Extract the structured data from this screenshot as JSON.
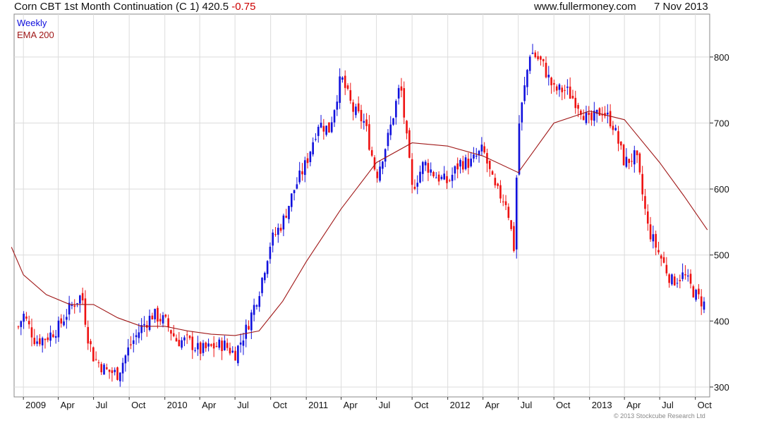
{
  "header": {
    "title": "Corn CBT 1st Month Continuation (C 1) 420.5",
    "change": "-0.75",
    "source": "www.fullermoney.com",
    "date": "7 Nov 2013"
  },
  "copyright": "© 2013 Stockcube Research Ltd",
  "colors": {
    "up": "#1010dd",
    "down": "#ee1111",
    "ema": "#a01818",
    "grid": "#dcdcdc",
    "frame": "#888888"
  },
  "chart_data": {
    "type": "candlestick",
    "frequency": "Weekly",
    "legend": [
      "Weekly",
      "EMA 200"
    ],
    "legend_placement": "top-left",
    "y_axis_side": "right",
    "ylim": [
      285,
      865
    ],
    "yticks": [
      300,
      400,
      500,
      600,
      700,
      800
    ],
    "x_ticks": [
      {
        "label": "2009",
        "date": "2009-01"
      },
      {
        "label": "Apr",
        "date": "2009-04"
      },
      {
        "label": "Jul",
        "date": "2009-07"
      },
      {
        "label": "Oct",
        "date": "2009-10"
      },
      {
        "label": "2010",
        "date": "2010-01"
      },
      {
        "label": "Apr",
        "date": "2010-04"
      },
      {
        "label": "Jul",
        "date": "2010-07"
      },
      {
        "label": "Oct",
        "date": "2010-10"
      },
      {
        "label": "2011",
        "date": "2011-01"
      },
      {
        "label": "Apr",
        "date": "2011-04"
      },
      {
        "label": "Jul",
        "date": "2011-07"
      },
      {
        "label": "Oct",
        "date": "2011-10"
      },
      {
        "label": "2012",
        "date": "2012-01"
      },
      {
        "label": "Apr",
        "date": "2012-04"
      },
      {
        "label": "Jul",
        "date": "2012-07"
      },
      {
        "label": "Oct",
        "date": "2012-10"
      },
      {
        "label": "2013",
        "date": "2013-01"
      },
      {
        "label": "Apr",
        "date": "2013-04"
      },
      {
        "label": "Jul",
        "date": "2013-07"
      },
      {
        "label": "Oct",
        "date": "2013-10"
      }
    ],
    "close_series": [
      {
        "date": "2008-12",
        "close": 365
      },
      {
        "date": "2009-01",
        "close": 410
      },
      {
        "date": "2009-02",
        "close": 370
      },
      {
        "date": "2009-03",
        "close": 375
      },
      {
        "date": "2009-04",
        "close": 390
      },
      {
        "date": "2009-05",
        "close": 420
      },
      {
        "date": "2009-06",
        "close": 440
      },
      {
        "date": "2009-06-15",
        "close": 380
      },
      {
        "date": "2009-07",
        "close": 345
      },
      {
        "date": "2009-08",
        "close": 325
      },
      {
        "date": "2009-09",
        "close": 320
      },
      {
        "date": "2009-10",
        "close": 360
      },
      {
        "date": "2009-11",
        "close": 390
      },
      {
        "date": "2009-12",
        "close": 410
      },
      {
        "date": "2010-01",
        "close": 400
      },
      {
        "date": "2010-02",
        "close": 370
      },
      {
        "date": "2010-03",
        "close": 370
      },
      {
        "date": "2010-04",
        "close": 355
      },
      {
        "date": "2010-05",
        "close": 360
      },
      {
        "date": "2010-06",
        "close": 365
      },
      {
        "date": "2010-07",
        "close": 350
      },
      {
        "date": "2010-08",
        "close": 390
      },
      {
        "date": "2010-09",
        "close": 445
      },
      {
        "date": "2010-10",
        "close": 520
      },
      {
        "date": "2010-11",
        "close": 550
      },
      {
        "date": "2010-12",
        "close": 600
      },
      {
        "date": "2011-01",
        "close": 640
      },
      {
        "date": "2011-02",
        "close": 700
      },
      {
        "date": "2011-03",
        "close": 690
      },
      {
        "date": "2011-04",
        "close": 770
      },
      {
        "date": "2011-05",
        "close": 720
      },
      {
        "date": "2011-06",
        "close": 700
      },
      {
        "date": "2011-07",
        "close": 620
      },
      {
        "date": "2011-08",
        "close": 680
      },
      {
        "date": "2011-09",
        "close": 760
      },
      {
        "date": "2011-10",
        "close": 600
      },
      {
        "date": "2011-11",
        "close": 640
      },
      {
        "date": "2011-12",
        "close": 620
      },
      {
        "date": "2012-01",
        "close": 610
      },
      {
        "date": "2012-02",
        "close": 640
      },
      {
        "date": "2012-03",
        "close": 640
      },
      {
        "date": "2012-04",
        "close": 660
      },
      {
        "date": "2012-05",
        "close": 600
      },
      {
        "date": "2012-06",
        "close": 580
      },
      {
        "date": "2012-06-20",
        "close": 510
      },
      {
        "date": "2012-07",
        "close": 690
      },
      {
        "date": "2012-08",
        "close": 810
      },
      {
        "date": "2012-09",
        "close": 790
      },
      {
        "date": "2012-10",
        "close": 750
      },
      {
        "date": "2012-11",
        "close": 750
      },
      {
        "date": "2012-12",
        "close": 730
      },
      {
        "date": "2013-01",
        "close": 700
      },
      {
        "date": "2013-02",
        "close": 720
      },
      {
        "date": "2013-03",
        "close": 700
      },
      {
        "date": "2013-04",
        "close": 640
      },
      {
        "date": "2013-05",
        "close": 650
      },
      {
        "date": "2013-06",
        "close": 540
      },
      {
        "date": "2013-07",
        "close": 500
      },
      {
        "date": "2013-08",
        "close": 460
      },
      {
        "date": "2013-09",
        "close": 470
      },
      {
        "date": "2013-10",
        "close": 440
      },
      {
        "date": "2013-11",
        "close": 420.5
      }
    ],
    "ema200": [
      {
        "date": "2008-12",
        "value": 512
      },
      {
        "date": "2009-01",
        "value": 470
      },
      {
        "date": "2009-03",
        "value": 440
      },
      {
        "date": "2009-05",
        "value": 425
      },
      {
        "date": "2009-07",
        "value": 425
      },
      {
        "date": "2009-09",
        "value": 405
      },
      {
        "date": "2009-11",
        "value": 392
      },
      {
        "date": "2010-01",
        "value": 392
      },
      {
        "date": "2010-03",
        "value": 385
      },
      {
        "date": "2010-05",
        "value": 380
      },
      {
        "date": "2010-07",
        "value": 378
      },
      {
        "date": "2010-09",
        "value": 385
      },
      {
        "date": "2010-11",
        "value": 430
      },
      {
        "date": "2011-01",
        "value": 490
      },
      {
        "date": "2011-04",
        "value": 570
      },
      {
        "date": "2011-07",
        "value": 640
      },
      {
        "date": "2011-10",
        "value": 670
      },
      {
        "date": "2012-01",
        "value": 665
      },
      {
        "date": "2012-04",
        "value": 650
      },
      {
        "date": "2012-07",
        "value": 625
      },
      {
        "date": "2012-10",
        "value": 700
      },
      {
        "date": "2013-01",
        "value": 718
      },
      {
        "date": "2013-04",
        "value": 705
      },
      {
        "date": "2013-07",
        "value": 640
      },
      {
        "date": "2013-09",
        "value": 590
      },
      {
        "date": "2013-11",
        "value": 538
      }
    ]
  }
}
